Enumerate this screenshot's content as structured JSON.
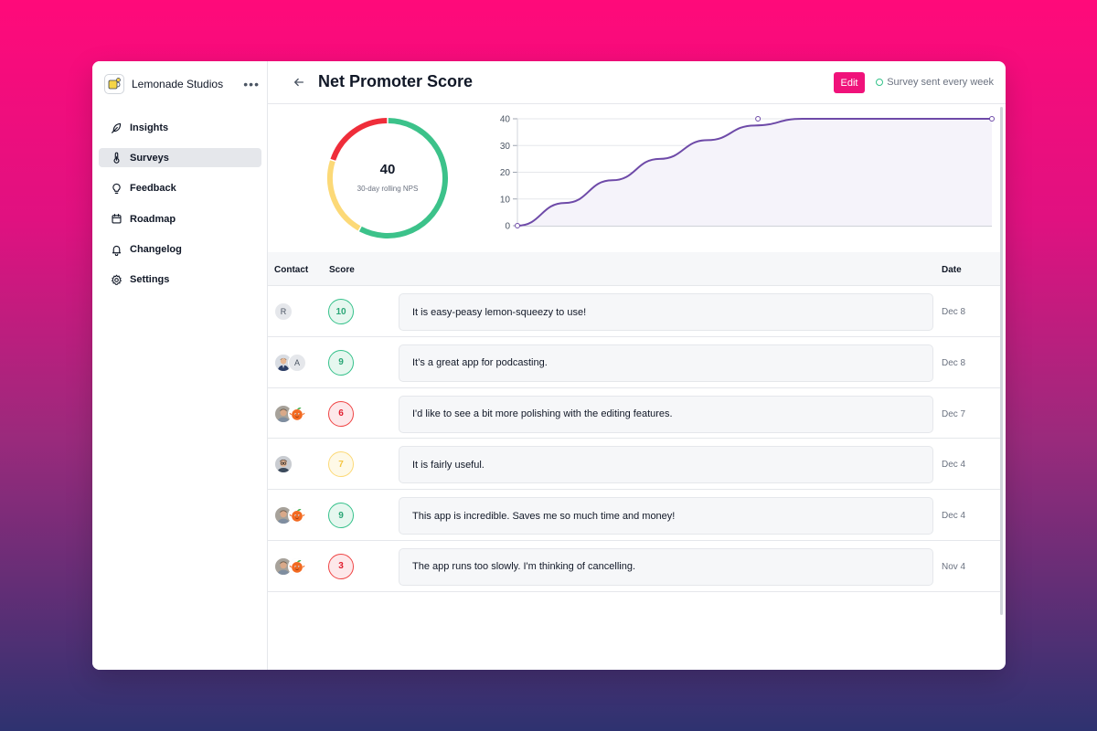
{
  "workspace": {
    "name": "Lemonade Studios",
    "more": "•••"
  },
  "nav": [
    {
      "label": "Insights",
      "icon": "feather-icon",
      "active": false
    },
    {
      "label": "Surveys",
      "icon": "thermometer-icon",
      "active": true
    },
    {
      "label": "Feedback",
      "icon": "lightbulb-icon",
      "active": false
    },
    {
      "label": "Roadmap",
      "icon": "calendar-icon",
      "active": false
    },
    {
      "label": "Changelog",
      "icon": "bell-icon",
      "active": false
    },
    {
      "label": "Settings",
      "icon": "gear-icon",
      "active": false
    }
  ],
  "header": {
    "title": "Net Promoter Score",
    "edit_label": "Edit",
    "status": "Survey sent every week"
  },
  "nps": {
    "value": "40",
    "label": "30-day rolling NPS",
    "segments": [
      {
        "name": "promoters",
        "fraction": 0.58,
        "color": "#3cc28a"
      },
      {
        "name": "passives",
        "fraction": 0.22,
        "color": "#fcd977"
      },
      {
        "name": "detractors",
        "fraction": 0.2,
        "color": "#ef2d3a"
      }
    ]
  },
  "chart_data": {
    "type": "area",
    "y_ticks": [
      "0",
      "10",
      "20",
      "30",
      "40"
    ],
    "ylim": [
      0,
      40
    ],
    "x": [
      0,
      1,
      2,
      3,
      4,
      5,
      6,
      7,
      8,
      9,
      10
    ],
    "values": [
      0,
      8.5,
      17,
      25,
      32,
      37.5,
      40,
      40,
      40,
      40,
      40
    ],
    "points": [
      {
        "x": 0,
        "y": 0
      },
      {
        "x": 5.07,
        "y": 40
      },
      {
        "x": 10,
        "y": 40
      }
    ],
    "line_color": "#6e4aa8",
    "fill_color": "#f5f3fa",
    "grid": true
  },
  "table": {
    "columns": {
      "contact": "Contact",
      "score": "Score",
      "date": "Date"
    },
    "rows": [
      {
        "avatars": [
          {
            "type": "initial",
            "text": "R"
          }
        ],
        "score": "10",
        "tone": "good",
        "comment": "It is easy-peasy lemon-squeezy to use!",
        "date": "Dec 8"
      },
      {
        "avatars": [
          {
            "type": "man-suit"
          },
          {
            "type": "initial",
            "text": "A"
          }
        ],
        "score": "9",
        "tone": "good",
        "comment": "It’s a great app for podcasting.",
        "date": "Dec 8"
      },
      {
        "avatars": [
          {
            "type": "man-photo"
          },
          {
            "type": "orange-mascot"
          }
        ],
        "score": "6",
        "tone": "bad",
        "comment": "I'd like to see a bit more polishing with the editing features.",
        "date": "Dec 7"
      },
      {
        "avatars": [
          {
            "type": "man-glasses"
          }
        ],
        "score": "7",
        "tone": "mid",
        "comment": "It is fairly useful.",
        "date": "Dec 4"
      },
      {
        "avatars": [
          {
            "type": "man-photo"
          },
          {
            "type": "orange-mascot"
          }
        ],
        "score": "9",
        "tone": "good",
        "comment": "This app is incredible. Saves me so much time and money!",
        "date": "Dec 4"
      },
      {
        "avatars": [
          {
            "type": "man-photo"
          },
          {
            "type": "orange-mascot"
          }
        ],
        "score": "3",
        "tone": "bad",
        "comment": "The app runs too slowly. I'm thinking of cancelling.",
        "date": "Nov 4"
      }
    ]
  }
}
